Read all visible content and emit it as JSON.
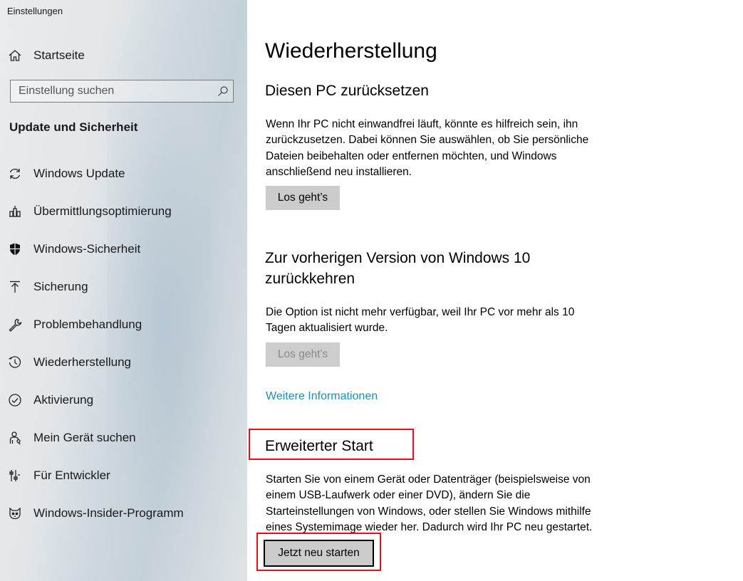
{
  "window": {
    "title": "Einstellungen"
  },
  "sidebar": {
    "home_label": "Startseite",
    "search_placeholder": "Einstellung suchen",
    "section_title": "Update und Sicherheit",
    "items": [
      {
        "label": "Windows Update",
        "icon": "refresh-icon"
      },
      {
        "label": "Übermittlungsoptimierung",
        "icon": "delivery-optimization-icon"
      },
      {
        "label": "Windows-Sicherheit",
        "icon": "shield-icon"
      },
      {
        "label": "Sicherung",
        "icon": "backup-arrow-icon"
      },
      {
        "label": "Problembehandlung",
        "icon": "wrench-icon"
      },
      {
        "label": "Wiederherstellung",
        "icon": "recovery-history-icon"
      },
      {
        "label": "Aktivierung",
        "icon": "check-circle-icon"
      },
      {
        "label": "Mein Gerät suchen",
        "icon": "person-locate-icon"
      },
      {
        "label": "Für Entwickler",
        "icon": "developer-sliders-icon"
      },
      {
        "label": "Windows-Insider-Programm",
        "icon": "insider-cat-icon"
      }
    ]
  },
  "main": {
    "title": "Wiederherstellung",
    "reset": {
      "heading": "Diesen PC zurücksetzen",
      "description": "Wenn Ihr PC nicht einwandfrei läuft, könnte es hilfreich sein, ihn zurückzusetzen. Dabei können Sie auswählen, ob Sie persönliche Dateien beibehalten oder entfernen möchten, und Windows anschließend neu installieren.",
      "button_label": "Los geht’s"
    },
    "rollback": {
      "heading_line1": "Zur vorherigen Version von Windows 10",
      "heading_line2": "zurückkehren",
      "description": "Die Option ist nicht mehr verfügbar, weil Ihr PC vor mehr als 10 Tagen aktualisiert wurde.",
      "button_label": "Los geht's"
    },
    "more_info_link": "Weitere Informationen",
    "advanced": {
      "heading": "Erweiterter Start",
      "description": "Starten Sie von einem Gerät oder Datenträger (beispielsweise von einem USB-Laufwerk oder einer DVD), ändern Sie die Starteinstellungen von Windows, oder stellen Sie Windows mithilfe eines Systemimage wieder her. Dadurch wird Ihr PC neu gestartet.",
      "button_label": "Jetzt neu starten"
    }
  },
  "colors": {
    "link": "#1a8fb3",
    "highlight": "#e0101e",
    "button_bg": "#cccccc"
  }
}
